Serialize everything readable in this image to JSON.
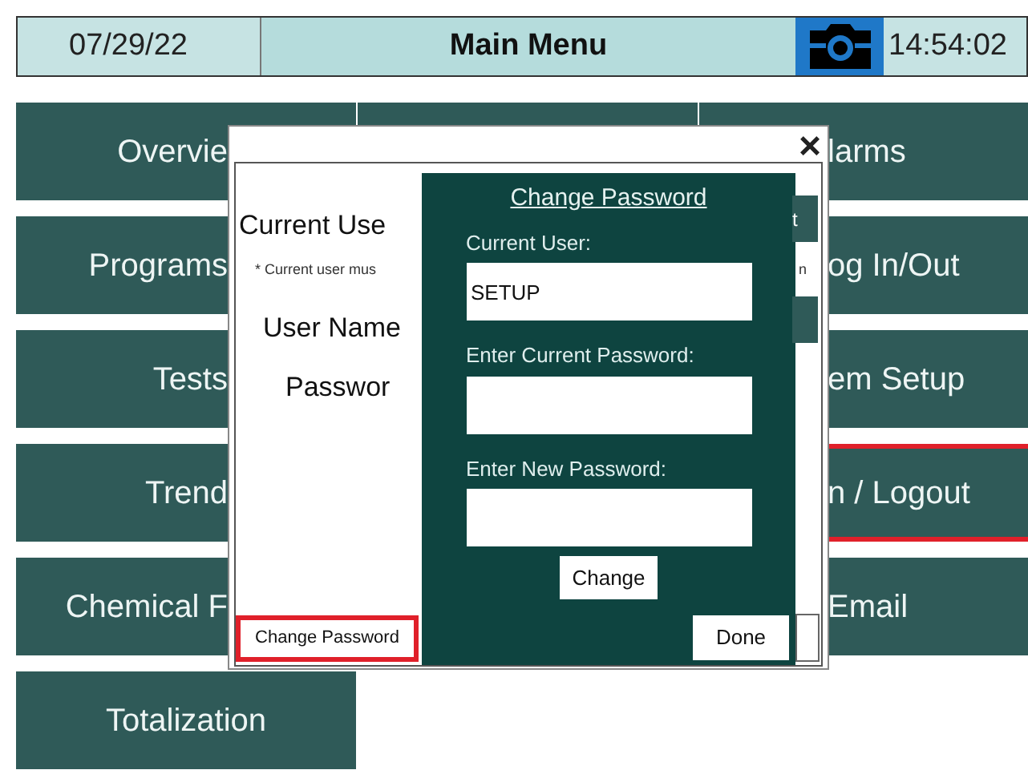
{
  "header": {
    "date": "07/29/22",
    "title": "Main Menu",
    "time": "14:54:02"
  },
  "menu_rows": [
    {
      "left": {
        "label": "Overvie",
        "selected": false
      },
      "right": {
        "label": "larms",
        "selected": false
      }
    },
    {
      "left": {
        "label": "Programs",
        "selected": false
      },
      "right": {
        "label": "og In/Out",
        "selected": false
      }
    },
    {
      "left": {
        "label": "Tests",
        "selected": false
      },
      "right": {
        "label": "em Setup",
        "selected": false
      }
    },
    {
      "left": {
        "label": "Trend",
        "selected": false
      },
      "right": {
        "label": "n / Logout",
        "selected": true
      }
    },
    {
      "left": {
        "label": "Chemical F",
        "selected": false
      },
      "right": {
        "label": "Email",
        "selected": false
      }
    },
    {
      "left": {
        "label": "Totalization",
        "selected": false
      }
    }
  ],
  "dialog": {
    "close": "×",
    "current_user_label": "Current Use",
    "note": "* Current user mus",
    "note_tail": "n",
    "user_name_label": "User Name",
    "password_label": "Passwor",
    "hidden_button_text": "t",
    "change_password_button": {
      "label": "Change Password",
      "selected": true
    },
    "panel": {
      "title": "Change Password",
      "fields": [
        {
          "label": "Current User:",
          "value": "SETUP"
        },
        {
          "label": "Enter Current Password:"
        },
        {
          "label": "Enter New Password:"
        }
      ],
      "change_button": "Change",
      "done_button": "Done"
    }
  }
}
